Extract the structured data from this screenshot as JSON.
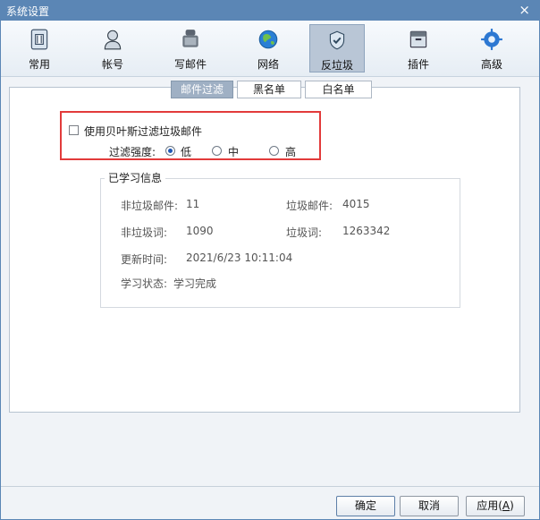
{
  "window": {
    "title": "系统设置"
  },
  "toolbar": {
    "items": [
      {
        "label": "常用",
        "icon": "sim-card-icon"
      },
      {
        "label": "帐号",
        "icon": "user-icon"
      },
      {
        "label": "写邮件",
        "icon": "compose-icon"
      },
      {
        "label": "网络",
        "icon": "globe-icon"
      },
      {
        "label": "反垃圾",
        "icon": "shield-check-icon",
        "active": true
      },
      {
        "label": "插件",
        "icon": "plugin-box-icon"
      },
      {
        "label": "高级",
        "icon": "gear-icon"
      }
    ]
  },
  "tabs": {
    "items": [
      {
        "label": "邮件过滤",
        "active": true
      },
      {
        "label": "黑名单",
        "active": false
      },
      {
        "label": "白名单",
        "active": false
      }
    ]
  },
  "filter": {
    "checkbox_label": "使用贝叶斯过滤垃圾邮件",
    "strength_label": "过滤强度:",
    "options": [
      "低",
      "中",
      "高"
    ],
    "selected": "低"
  },
  "learned": {
    "title": "已学习信息",
    "rows": [
      {
        "left_label": "非垃圾邮件:",
        "left_value": "11",
        "right_label": "垃圾邮件:",
        "right_value": "4015"
      },
      {
        "left_label": "非垃圾词:",
        "left_value": "1090",
        "right_label": "垃圾词:",
        "right_value": "1263342"
      }
    ],
    "update_label": "更新时间:",
    "update_value": "2021/6/23 10:11:04",
    "status_label": "学习状态:",
    "status_value": "学习完成"
  },
  "buttons": {
    "ok": "确定",
    "cancel": "取消",
    "apply_prefix": "应用(",
    "apply_key": "A",
    "apply_suffix": ")"
  },
  "colors": {
    "titlebar": "#5b86b5",
    "highlight": "#e23b3b",
    "radio": "#1f58b5"
  }
}
